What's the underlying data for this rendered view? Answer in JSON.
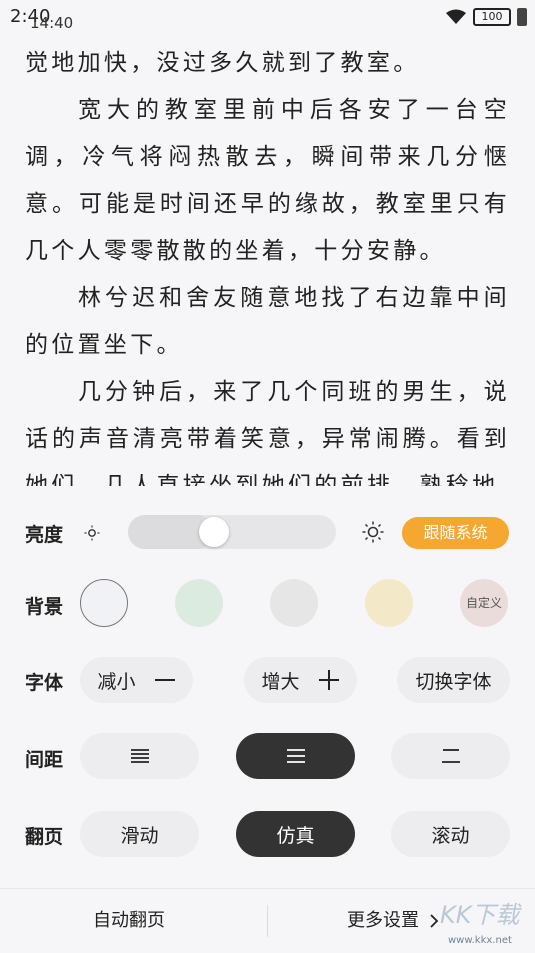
{
  "status_bar": {
    "time": "2:40",
    "time_overlay": "14:40",
    "battery": "100"
  },
  "reader": {
    "paragraphs": [
      {
        "text": "觉地加快，没过多久就到了教室。",
        "indent": false
      },
      {
        "text": "宽大的教室里前中后各安了一台空调，冷气将闷热散去，瞬间带来几分惬意。可能是时间还早的缘故，教室里只有几个人零零散散的坐着，十分安静。",
        "indent": true
      },
      {
        "text": "林兮迟和舍友随意地找了右边靠中间的位置坐下。",
        "indent": true
      },
      {
        "text": "几分钟后，来了几个同班的男生，说话的声音清亮带着笑意，异常闹腾。看到她们，几人直接坐到她们的前排，熟稔地",
        "indent": true
      }
    ]
  },
  "settings": {
    "brightness": {
      "label": "亮度",
      "level": 0.4,
      "follow_system": "跟随系统"
    },
    "background": {
      "label": "背景",
      "swatches": [
        {
          "color": "#f1f2f5",
          "selected": true
        },
        {
          "color": "#dcebe0",
          "selected": false
        },
        {
          "color": "#e6e6e6",
          "selected": false
        },
        {
          "color": "#f3e9c8",
          "selected": false
        },
        {
          "color": "#ebdcdc",
          "selected": false,
          "label": "自定义"
        }
      ]
    },
    "font": {
      "label": "字体",
      "decrease": "减小",
      "increase": "增大",
      "switch": "切换字体"
    },
    "spacing": {
      "label": "间距",
      "options": [
        "compact",
        "standard",
        "loose"
      ],
      "selected": 1
    },
    "page_turn": {
      "label": "翻页",
      "options": [
        "滑动",
        "仿真",
        "滚动"
      ],
      "selected": 1
    }
  },
  "bottom_bar": {
    "auto_turn": "自动翻页",
    "more_settings": "更多设置",
    "more_icon": "chevron-right-icon"
  },
  "watermark": {
    "text": "KK下载",
    "url": "www.kkx.net"
  }
}
